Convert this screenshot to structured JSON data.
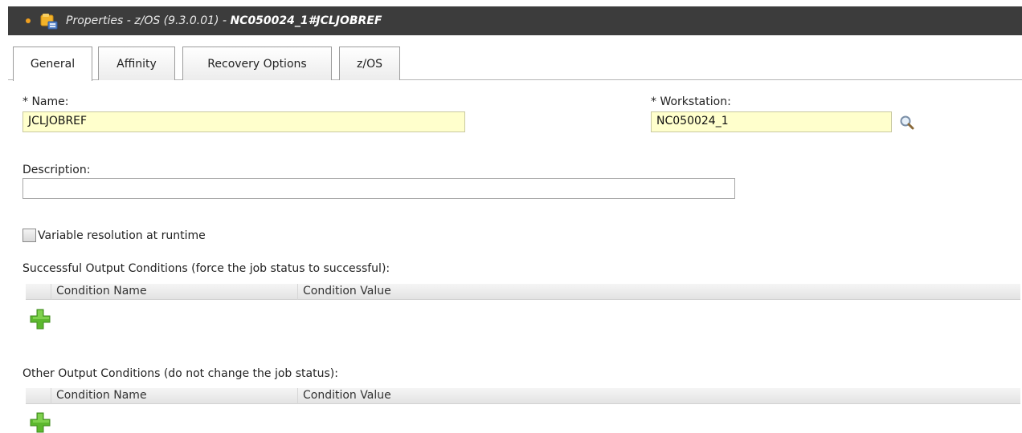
{
  "window": {
    "title_prefix": "Properties - z/OS (9.3.0.01) - ",
    "title_object": "NC050024_1#JCLJOBREF"
  },
  "tabs": [
    {
      "label": "General",
      "active": true
    },
    {
      "label": "Affinity",
      "active": false
    },
    {
      "label": "Recovery Options",
      "active": false
    },
    {
      "label": "z/OS",
      "active": false
    }
  ],
  "form": {
    "name_label": "* Name:",
    "name_value": "JCLJOBREF",
    "workstation_label": "* Workstation:",
    "workstation_value": "NC050024_1",
    "description_label": "Description:",
    "description_value": "",
    "variable_resolution_label": "Variable resolution at runtime",
    "variable_resolution_checked": false
  },
  "successful_conditions": {
    "heading": "Successful Output Conditions (force the job status to successful):",
    "columns": [
      "Condition Name",
      "Condition Value"
    ],
    "rows": []
  },
  "other_conditions": {
    "heading": "Other Output Conditions (do not change the job status):",
    "columns": [
      "Condition Name",
      "Condition Value"
    ],
    "rows": []
  },
  "icons": {
    "window": "job-properties-icon",
    "lookup": "magnifier-icon",
    "add": "green-plus-icon"
  },
  "colors": {
    "titlebar_bg": "#3c3c3c",
    "required_field_bg": "#ffffcc",
    "add_icon_green": "#5cb82e"
  }
}
